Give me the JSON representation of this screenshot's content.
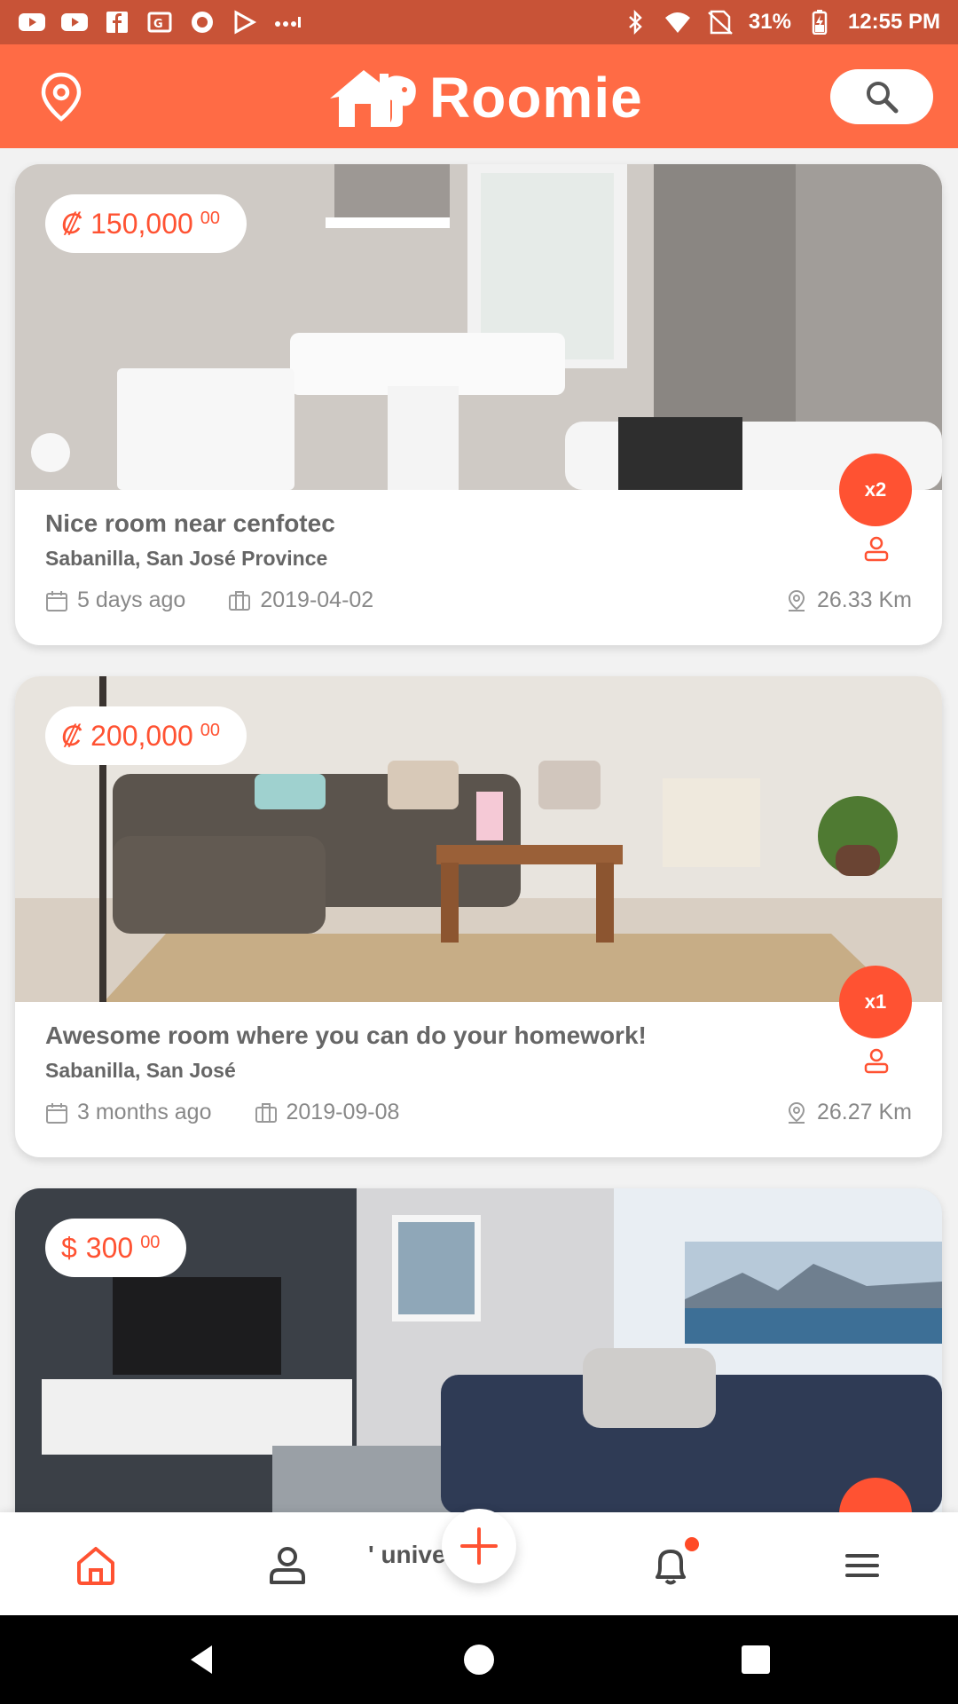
{
  "status_bar": {
    "battery": "31%",
    "time": "12:55 PM",
    "icons": [
      "youtube-icon",
      "youtube-icon",
      "facebook-icon",
      "google-news-icon",
      "record-icon",
      "play-store-icon",
      "more-dots-icon",
      "bluetooth-icon",
      "wifi-icon",
      "no-sim-icon",
      "battery-charging-icon"
    ]
  },
  "header": {
    "app_name": "Roomie",
    "left_icon": "location-pin-icon",
    "right_icon": "search-icon"
  },
  "listings": [
    {
      "currency": "₡",
      "price": "150,000",
      "cents": "00",
      "title": "Nice room near cenfotec",
      "location": "Sabanilla, San José Province",
      "posted": "5 days ago",
      "available": "2019-04-02",
      "distance": "26.33 Km",
      "occupancy": "x2"
    },
    {
      "currency": "₡",
      "price": "200,000",
      "cents": "00",
      "title": "Awesome room where you can do your homework!",
      "location": "Sabanilla, San José",
      "posted": "3 months ago",
      "available": "2019-09-08",
      "distance": "26.27 Km",
      "occupancy": "x1"
    },
    {
      "currency": "$",
      "price": "300",
      "cents": "00"
    }
  ],
  "bottom_nav": {
    "peek_text": "' unive   .",
    "items": [
      "home-icon",
      "profile-icon",
      "add-icon",
      "bell-icon",
      "menu-icon"
    ]
  },
  "colors": {
    "status_bar": "#c85337",
    "header": "#ff6b45",
    "accent": "#ff5232"
  }
}
